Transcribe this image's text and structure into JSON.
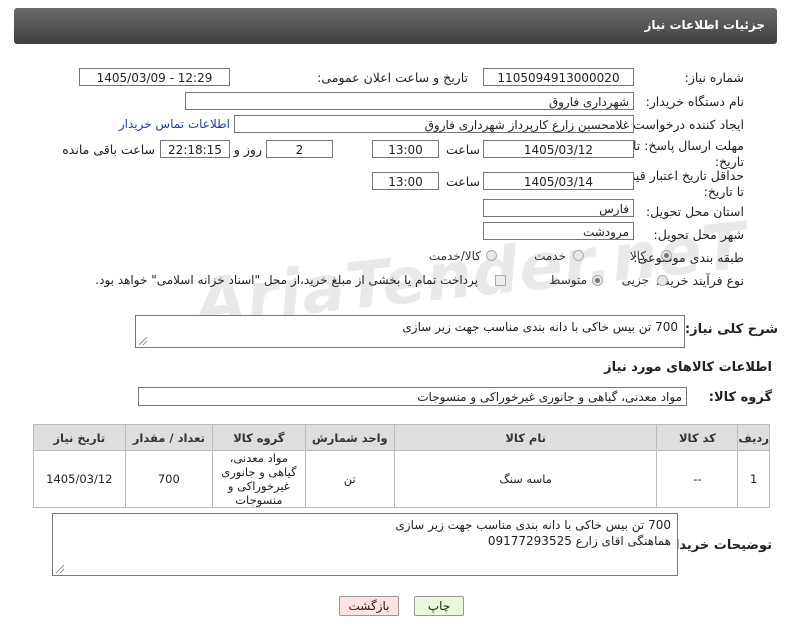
{
  "header": {
    "title": "جزئیات اطلاعات نیاز"
  },
  "fields": {
    "need_number": {
      "label": "شماره نیاز:",
      "value": "1105094913000020"
    },
    "announce_datetime": {
      "label": "تاریخ و ساعت اعلان عمومی:",
      "value": "1405/03/09 - 12:29"
    },
    "buyer_org": {
      "label": "نام دستگاه خریدار:",
      "value": "شهرداری فاروق"
    },
    "requester": {
      "label": "ایجاد کننده درخواست:",
      "value": "غلامحسین زارع کارپرداز شهرداری فاروق",
      "contact_link": "اطلاعات تماس خریدار"
    },
    "reply_deadline": {
      "label": "مهلت ارسال پاسخ: تا تاریخ:",
      "date": "1405/03/12",
      "time_label": "ساعت",
      "time": "13:00",
      "days": "2",
      "days_label": "روز و",
      "remaining": "22:18:15",
      "remaining_label": "ساعت باقی مانده"
    },
    "price_validity": {
      "label": "حداقل تاریخ اعتبار قیمت: تا تاریخ:",
      "date": "1405/03/14",
      "time_label": "ساعت",
      "time": "13:00"
    },
    "province": {
      "label": "استان محل تحویل:",
      "value": "فارس"
    },
    "city": {
      "label": "شهر محل تحویل:",
      "value": "مرودشت"
    },
    "category": {
      "label": "طبقه بندی موضوعی:",
      "options": [
        "کالا",
        "خدمت",
        "کالا/خدمت"
      ]
    },
    "process_type": {
      "label": "نوع فرآیند خرید :",
      "options": [
        "جزیی",
        "متوسط"
      ],
      "checkbox_text": "پرداخت تمام یا بخشی از مبلغ خرید،از محل \"اسناد خزانه اسلامی\" خواهد بود."
    },
    "description": {
      "label": "شرح کلی نیاز:",
      "value": "700 تن بیس خاکی با دانه بندی مناسب جهت زیر سازی"
    }
  },
  "goods": {
    "section_title": "اطلاعات کالاهای مورد نیاز",
    "group_label": "گروه کالا:",
    "group_value": "مواد معدنی، گیاهی و جانوری غیرخوراکی و منسوجات",
    "table": {
      "headers": [
        "ردیف",
        "کد کالا",
        "نام کالا",
        "واحد شمارش",
        "گروه کالا",
        "تعداد / مقدار",
        "تاریخ نیاز"
      ],
      "rows": [
        [
          "1",
          "--",
          "ماسه سنگ",
          "تن",
          "مواد معدنی، گیاهی و جانوری غیرخوراکی و منسوجات",
          "700",
          "1405/03/12"
        ]
      ]
    }
  },
  "buyer_notes": {
    "label": "توضیحات خریدار:",
    "line1": "700 تن بیس خاکی با دانه بندی مناسب جهت زیر سازی",
    "line2": "هماهنگی اقای زارع 09177293525"
  },
  "buttons": {
    "print": "چاپ",
    "back": "بازگشت"
  },
  "watermark": {
    "text": "AriaTender.neT"
  },
  "colors": {
    "header_bg": "#505050",
    "link": "#1a3fb0",
    "print_btn": "#eaf7d9",
    "back_btn": "#fbe3e3"
  }
}
